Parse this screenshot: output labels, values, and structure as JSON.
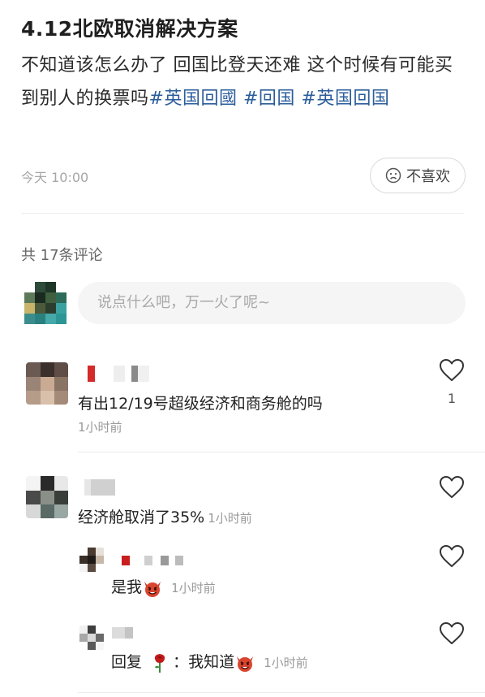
{
  "post": {
    "title": "4.12北欧取消解决方案",
    "body_text": "不知道该怎么办了 回国比登天还难 这个时候有可能买到别人的换票吗",
    "tags": [
      "#英国回國",
      "#回国",
      "#英国回国"
    ],
    "time": "今天 10:00",
    "dislike_label": "不喜欢"
  },
  "comments_header": {
    "count_label": "共 17条评论"
  },
  "comment_input": {
    "placeholder": "说点什么吧，万一火了呢~"
  },
  "comments": [
    {
      "text": "有出12/19号超级经济和商务舱的吗",
      "time": "1小时前",
      "likes": "1",
      "replies": []
    },
    {
      "text": "经济舱取消了35%",
      "time": "1小时前",
      "likes": "",
      "replies": [
        {
          "text": "是我",
          "emoji": "devil-emoji",
          "time": "1小时前"
        },
        {
          "prefix": "回复",
          "emoji_rose": "rose-emoji",
          "colon": "：",
          "text": "我知道",
          "emoji": "devil-emoji",
          "time": "1小时前"
        }
      ]
    }
  ],
  "colors": {
    "tag": "#2b5d9b",
    "muted": "#9a9a9a",
    "input_bg": "#f5f5f5"
  }
}
